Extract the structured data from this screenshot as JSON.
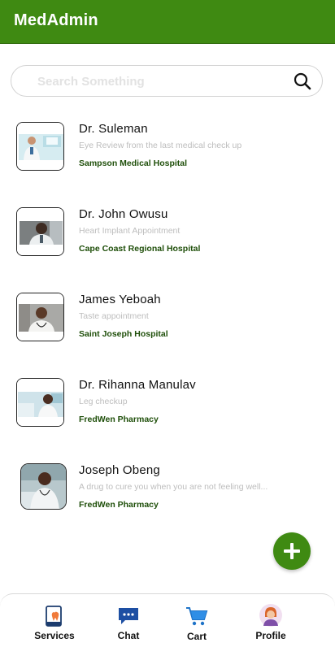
{
  "header": {
    "title": "MedAdmin",
    "color": "#3f8a12"
  },
  "search": {
    "placeholder": "Search Something",
    "value": ""
  },
  "doctors": [
    {
      "name": "Dr. Suleman",
      "description": "Eye Review from the last medical check up",
      "hospital": "Sampson Medical Hospital"
    },
    {
      "name": "Dr. John Owusu",
      "description": "Heart Implant Appointment",
      "hospital": "Cape Coast Regional Hospital"
    },
    {
      "name": "James Yeboah",
      "description": "Taste appointment",
      "hospital": "Saint Joseph Hospital"
    },
    {
      "name": "Dr. Rihanna  Manulav",
      "description": "Leg checkup",
      "hospital": "FredWen Pharmacy"
    },
    {
      "name": "Joseph Obeng",
      "description": "A drug to cure you when you are not feeling well...",
      "hospital": "FredWen Pharmacy"
    }
  ],
  "fab": {
    "icon": "plus-icon"
  },
  "nav": {
    "services_label": "Services",
    "chat_label": "Chat",
    "cart_label": "Cart",
    "profile_label": "Profile"
  }
}
